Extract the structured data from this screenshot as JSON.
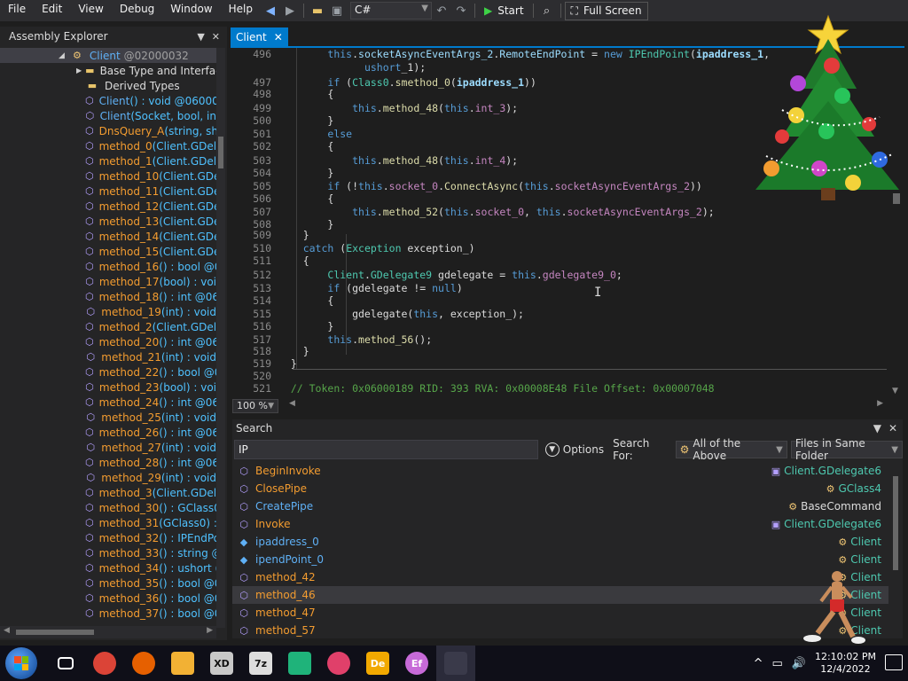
{
  "menu": [
    "File",
    "Edit",
    "View",
    "Debug",
    "Window",
    "Help"
  ],
  "toolbar": {
    "language": "C#",
    "start_label": "Start",
    "fullscreen_label": "Full Screen"
  },
  "assembly_explorer": {
    "title": "Assembly Explorer",
    "items": [
      {
        "icon": "class-icon",
        "name": "Client",
        "sig": "@02000032",
        "style": "class"
      },
      {
        "icon": "folder-icon",
        "name": "Base Type and Interfac",
        "sig": "",
        "style": "folder"
      },
      {
        "icon": "folder-icon",
        "name": "Derived Types",
        "sig": "",
        "style": "folder"
      },
      {
        "icon": "method-icon",
        "name": "Client",
        "sig": "() : void @06000",
        "style": "blue"
      },
      {
        "icon": "method-icon",
        "name": "Client",
        "sig": "(Socket, bool, in",
        "style": "blue"
      },
      {
        "icon": "method-lock-icon",
        "name": "DnsQuery_A",
        "sig": "(string, sh",
        "style": "orange"
      },
      {
        "icon": "method-lock-icon",
        "name": "method_0",
        "sig": "(Client.GDel",
        "style": "orange"
      },
      {
        "icon": "method-lock-icon",
        "name": "method_1",
        "sig": "(Client.GDel",
        "style": "orange"
      },
      {
        "icon": "method-lock-icon",
        "name": "method_10",
        "sig": "(Client.GDe",
        "style": "orange"
      },
      {
        "icon": "method-lock-icon",
        "name": "method_11",
        "sig": "(Client.GDe",
        "style": "orange"
      },
      {
        "icon": "method-lock-icon",
        "name": "method_12",
        "sig": "(Client.GDe",
        "style": "orange"
      },
      {
        "icon": "method-lock-icon",
        "name": "method_13",
        "sig": "(Client.GDe",
        "style": "orange"
      },
      {
        "icon": "method-lock-icon",
        "name": "method_14",
        "sig": "(Client.GDe",
        "style": "orange"
      },
      {
        "icon": "method-lock-icon",
        "name": "method_15",
        "sig": "(Client.GDe",
        "style": "orange"
      },
      {
        "icon": "method-lock-icon",
        "name": "method_16",
        "sig": "() : bool @0",
        "style": "orange"
      },
      {
        "icon": "method-lock-icon",
        "name": "method_17",
        "sig": "(bool) : voi",
        "style": "orange"
      },
      {
        "icon": "method-lock-icon",
        "name": "method_18",
        "sig": "() : int @06",
        "style": "orange"
      },
      {
        "icon": "method-lock-icon",
        "name": "method_19",
        "sig": "(int) : void",
        "style": "orange"
      },
      {
        "icon": "method-lock-icon",
        "name": "method_2",
        "sig": "(Client.GDel",
        "style": "orange"
      },
      {
        "icon": "method-lock-icon",
        "name": "method_20",
        "sig": "() : int @06",
        "style": "orange"
      },
      {
        "icon": "method-lock-icon",
        "name": "method_21",
        "sig": "(int) : void",
        "style": "orange"
      },
      {
        "icon": "method-lock-icon",
        "name": "method_22",
        "sig": "() : bool @0",
        "style": "orange"
      },
      {
        "icon": "method-lock-icon",
        "name": "method_23",
        "sig": "(bool) : voi",
        "style": "orange"
      },
      {
        "icon": "method-lock-icon",
        "name": "method_24",
        "sig": "() : int @06",
        "style": "orange"
      },
      {
        "icon": "method-lock-icon",
        "name": "method_25",
        "sig": "(int) : void",
        "style": "orange"
      },
      {
        "icon": "method-lock-icon",
        "name": "method_26",
        "sig": "() : int @06",
        "style": "orange"
      },
      {
        "icon": "method-lock-icon",
        "name": "method_27",
        "sig": "(int) : void",
        "style": "orange"
      },
      {
        "icon": "method-lock-icon",
        "name": "method_28",
        "sig": "() : int @06",
        "style": "orange"
      },
      {
        "icon": "method-lock-icon",
        "name": "method_29",
        "sig": "(int) : void",
        "style": "orange"
      },
      {
        "icon": "method-lock-icon",
        "name": "method_3",
        "sig": "(Client.GDel",
        "style": "orange"
      },
      {
        "icon": "method-lock-icon",
        "name": "method_30",
        "sig": "() : GClass0",
        "style": "orange"
      },
      {
        "icon": "method-lock-icon",
        "name": "method_31",
        "sig": "(GClass0) :",
        "style": "orange"
      },
      {
        "icon": "method-lock-icon",
        "name": "method_32",
        "sig": "() : IPEndPo",
        "style": "orange"
      },
      {
        "icon": "method-lock-icon",
        "name": "method_33",
        "sig": "() : string @",
        "style": "orange"
      },
      {
        "icon": "method-lock-icon",
        "name": "method_34",
        "sig": "() : ushort (",
        "style": "orange"
      },
      {
        "icon": "method-lock-icon",
        "name": "method_35",
        "sig": "() : bool @0",
        "style": "orange"
      },
      {
        "icon": "method-lock-icon",
        "name": "method_36",
        "sig": "() : bool @0",
        "style": "orange"
      },
      {
        "icon": "method-lock-icon",
        "name": "method_37",
        "sig": "() : bool @0",
        "style": "orange"
      }
    ]
  },
  "document_tab": {
    "label": "Client"
  },
  "code": {
    "lines": [
      {
        "n": "496",
        "h": "<span class='k'>this</span>.<span class='f'>socketAsyncEventArgs_2</span>.<span class='f'>RemoteEndPoint</span> = <span class='k'>new</span> <span class='t'>IPEndPoint</span>(<span class='p'>ipaddress_1</span>,"
      },
      {
        "n": "",
        "h": "    <span class='k'>ushort</span>_1);"
      },
      {
        "n": "497",
        "h": "<span class='k'>if</span> (<span class='t'>Class0</span>.<span class='m'>smethod_0</span>(<span class='p'>ipaddress_1</span>))"
      },
      {
        "n": "498",
        "h": "{"
      },
      {
        "n": "499",
        "h": "    <span class='k'>this</span>.<span class='m'>method_48</span>(<span class='k'>this</span>.<span class='f2'>int_3</span>);"
      },
      {
        "n": "500",
        "h": "}"
      },
      {
        "n": "501",
        "h": "<span class='k'>else</span>"
      },
      {
        "n": "502",
        "h": "{"
      },
      {
        "n": "503",
        "h": "    <span class='k'>this</span>.<span class='m'>method_48</span>(<span class='k'>this</span>.<span class='f2'>int_4</span>);"
      },
      {
        "n": "504",
        "h": "}"
      },
      {
        "n": "505",
        "h": "<span class='k'>if</span> (!<span class='k'>this</span>.<span class='f2'>socket_0</span>.<span class='m'>ConnectAsync</span>(<span class='k'>this</span>.<span class='f2'>socketAsyncEventArgs_2</span>))"
      },
      {
        "n": "506",
        "h": "{"
      },
      {
        "n": "507",
        "h": "    <span class='k'>this</span>.<span class='m'>method_52</span>(<span class='k'>this</span>.<span class='f2'>socket_0</span>, <span class='k'>this</span>.<span class='f2'>socketAsyncEventArgs_2</span>);"
      },
      {
        "n": "508",
        "h": "}"
      },
      {
        "n": "509",
        "h": "}"
      },
      {
        "n": "510",
        "h": "<span class='k'>catch</span> (<span class='t'>Exception</span> exception_)"
      },
      {
        "n": "511",
        "h": "{"
      },
      {
        "n": "512",
        "h": "    <span class='t'>Client</span>.<span class='t'>GDelegate9</span> gdelegate = <span class='k'>this</span>.<span class='f2'>gdelegate9_0</span>;"
      },
      {
        "n": "513",
        "h": "    <span class='k'>if</span> (gdelegate != <span class='k'>null</span>)"
      },
      {
        "n": "514",
        "h": "    {"
      },
      {
        "n": "515",
        "h": "        gdelegate(<span class='k'>this</span>, exception_);"
      },
      {
        "n": "516",
        "h": "    }"
      },
      {
        "n": "517",
        "h": "    <span class='k'>this</span>.<span class='m'>method_56</span>();"
      },
      {
        "n": "518",
        "h": "}"
      },
      {
        "n": "519",
        "h": "}"
      },
      {
        "n": "520",
        "h": ""
      },
      {
        "n": "521",
        "h": "<span class='c'>// Token: 0x06000189 RID: 393 RVA: 0x00008E48 File Offset: 0x00007048</span>"
      }
    ]
  },
  "zoom": "100 %",
  "search": {
    "title": "Search",
    "query": "IP",
    "options_label": "Options",
    "search_for_label": "Search For:",
    "search_for_value": "All of the Above",
    "scope_value": "Files in Same Folder",
    "results": [
      {
        "icon": "method-icon",
        "name": "BeginInvoke",
        "owner_icon": "delegate-icon",
        "owner": "Client.GDelegate6",
        "style": "orange",
        "owner_style": "type"
      },
      {
        "icon": "method-icon",
        "name": "ClosePipe",
        "owner_icon": "class-icon",
        "owner": "GClass4",
        "style": "orange",
        "owner_style": "type"
      },
      {
        "icon": "method-icon",
        "name": "CreatePipe",
        "owner_icon": "class-icon",
        "owner": "BaseCommand",
        "style": "blue",
        "owner_style": "plain"
      },
      {
        "icon": "method-icon",
        "name": "Invoke",
        "owner_icon": "delegate-icon",
        "owner": "Client.GDelegate6",
        "style": "orange",
        "owner_style": "type"
      },
      {
        "icon": "field-icon",
        "name": "ipaddress_0",
        "owner_icon": "class-icon",
        "owner": "Client",
        "style": "blue",
        "owner_style": "type"
      },
      {
        "icon": "field-icon",
        "name": "ipendPoint_0",
        "owner_icon": "class-icon",
        "owner": "Client",
        "style": "blue",
        "owner_style": "type"
      },
      {
        "icon": "method-lock-icon",
        "name": "method_42",
        "owner_icon": "class-icon",
        "owner": "Client",
        "style": "orange",
        "owner_style": "type"
      },
      {
        "icon": "method-lock-icon",
        "name": "method_46",
        "owner_icon": "class-icon",
        "owner": "Client",
        "style": "orange",
        "owner_style": "type"
      },
      {
        "icon": "method-lock-icon",
        "name": "method_47",
        "owner_icon": "class-icon",
        "owner": "Client",
        "style": "orange",
        "owner_style": "type"
      },
      {
        "icon": "method-lock-icon",
        "name": "method_57",
        "owner_icon": "class-icon",
        "owner": "Client",
        "style": "orange",
        "owner_style": "type"
      }
    ]
  },
  "taskbar": {
    "apps": [
      {
        "name": "task-view",
        "label": "",
        "color": "#0f0f18"
      },
      {
        "name": "chrome",
        "label": "",
        "color": "#db4437"
      },
      {
        "name": "firefox",
        "label": "",
        "color": "#e66000"
      },
      {
        "name": "file-explorer",
        "label": "",
        "color": "#f2b134"
      },
      {
        "name": "app-xd",
        "label": "XD",
        "color": "#c8c8c8"
      },
      {
        "name": "7zip",
        "label": "7z",
        "color": "#dddddd"
      },
      {
        "name": "app-green",
        "label": "",
        "color": "#1fb37a"
      },
      {
        "name": "app-red",
        "label": "",
        "color": "#e0406a"
      },
      {
        "name": "app-de",
        "label": "De",
        "color": "#f2a900"
      },
      {
        "name": "app-ef",
        "label": "Ef",
        "color": "#c76ad8"
      },
      {
        "name": "app-windows",
        "label": "",
        "color": "#3a3a4a"
      }
    ],
    "time": "12:10:02 PM",
    "date": "12/4/2022"
  }
}
